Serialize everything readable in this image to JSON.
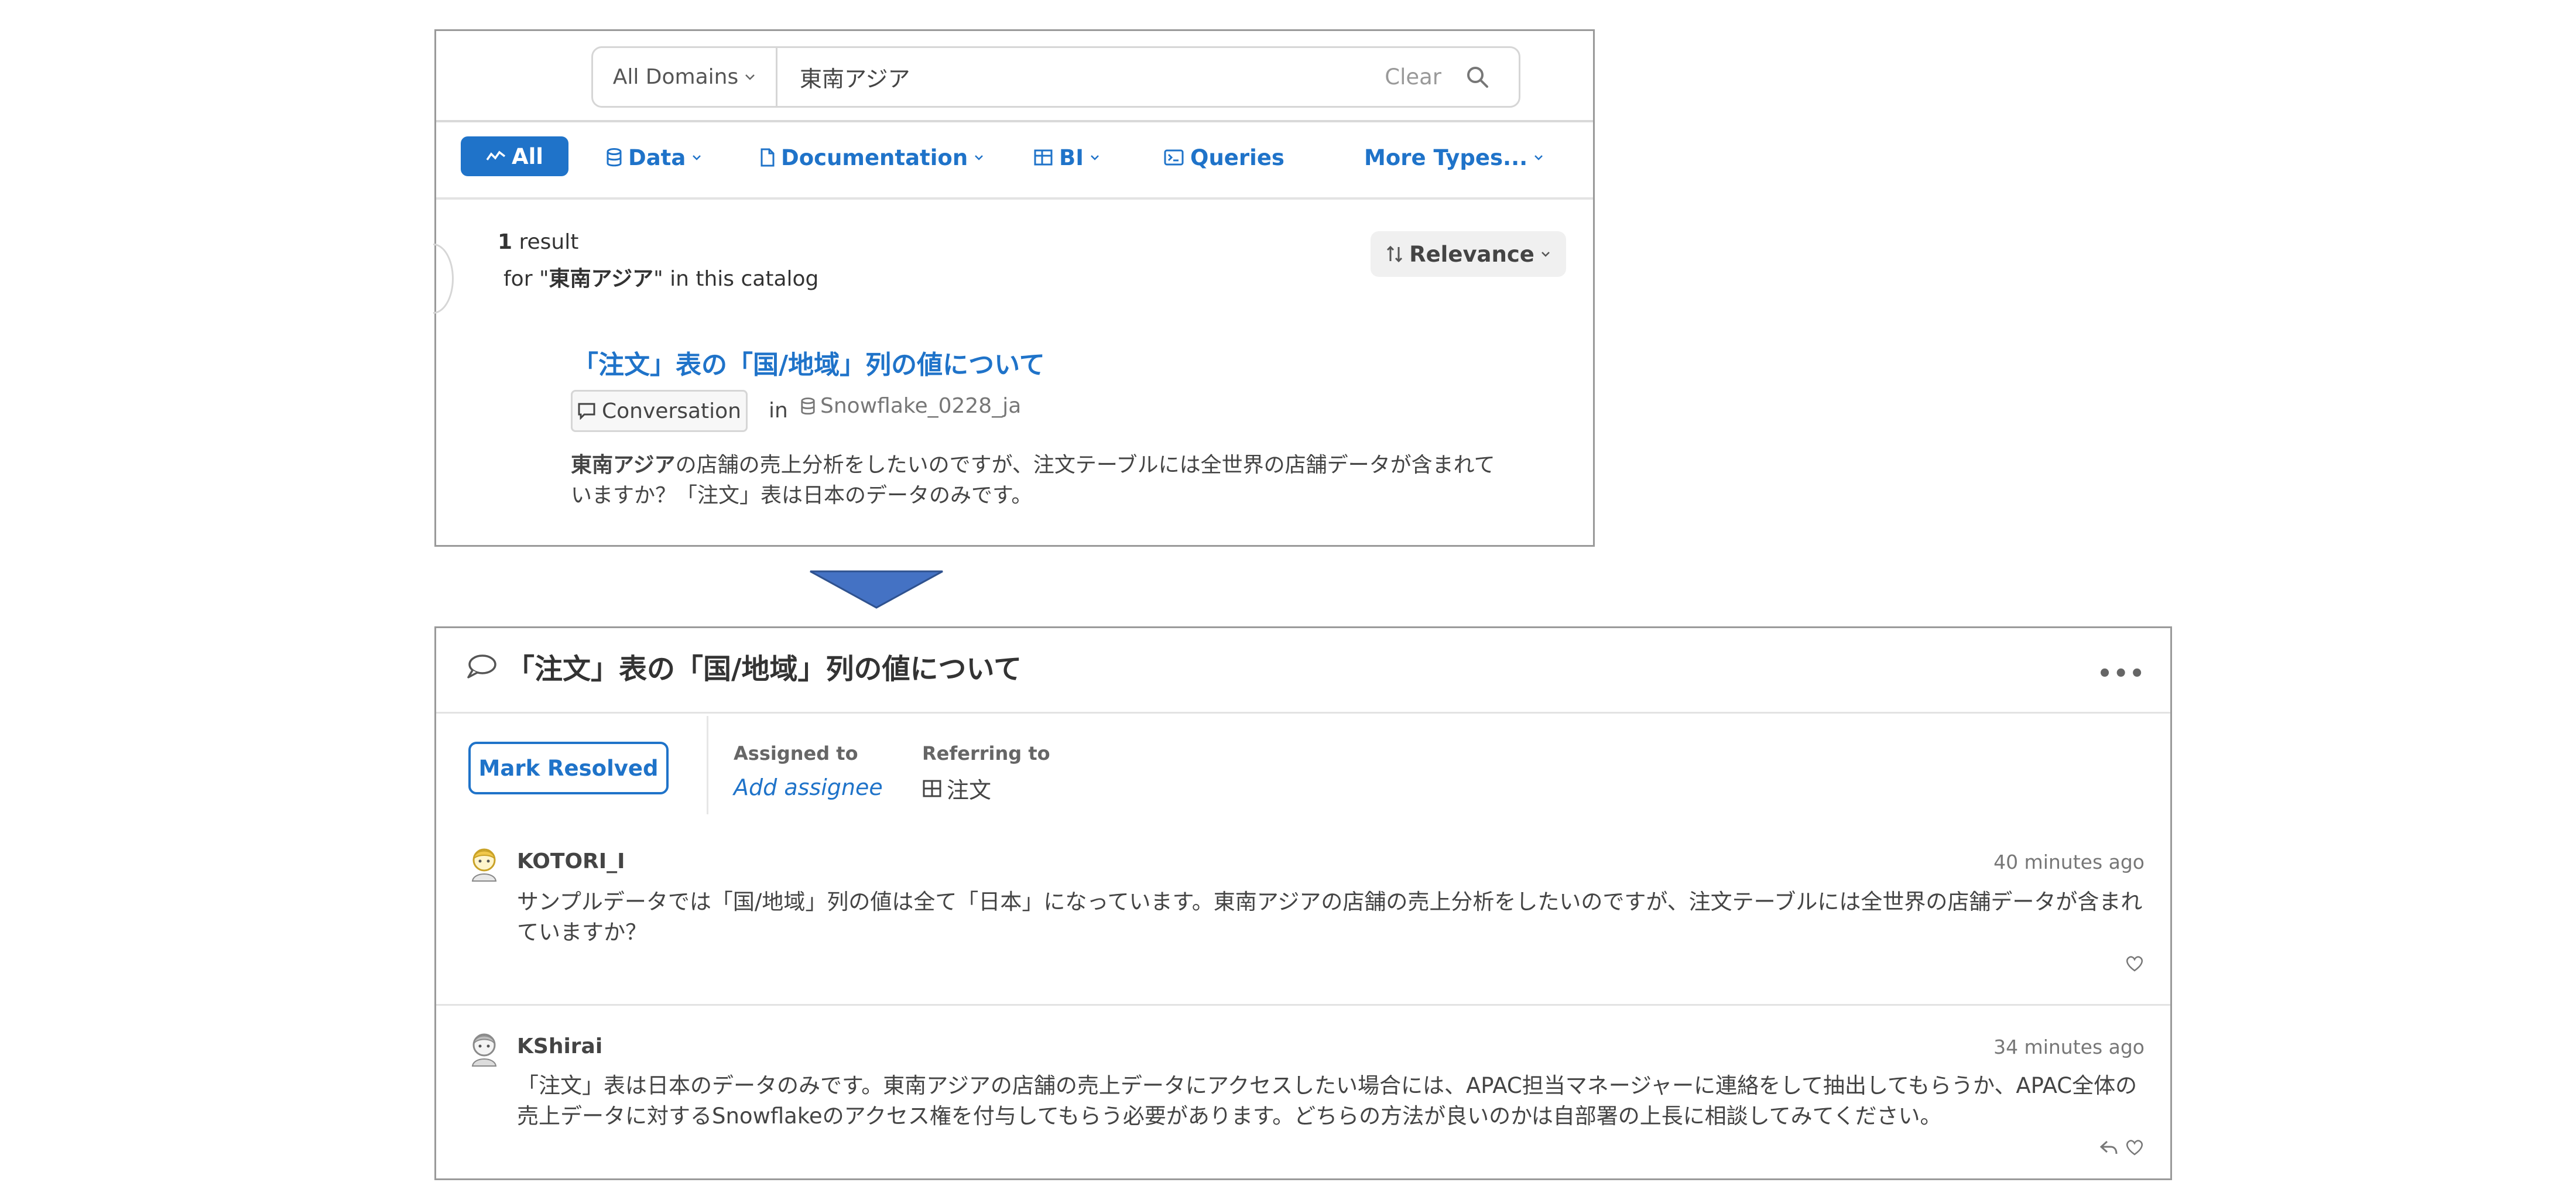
{
  "search": {
    "domain": "All Domains",
    "query": "東南アジア",
    "clear_label": "Clear"
  },
  "types": {
    "all": "All",
    "data": "Data",
    "documentation": "Documentation",
    "bi": "BI",
    "queries": "Queries",
    "more": "More Types..."
  },
  "results": {
    "count": "1",
    "count_suffix": " result",
    "for_prefix": "for \"",
    "for_query": "東南アジア",
    "for_suffix": "\" in this catalog",
    "sort_label": "Relevance",
    "item": {
      "title": "「注文」表の「国/地域」列の値について",
      "type": "Conversation",
      "in_label": "in",
      "source": "Snowflake_0228_ja",
      "snippet_bold": "東南アジア",
      "snippet_rest": "の店舗の売上分析をしたいのですが、注文テーブルには全世界の店舗データが含まれていますか？「注文」表は日本のデータのみです。"
    }
  },
  "conversation": {
    "title": "「注文」表の「国/地域」列の値について",
    "more_label": "•••",
    "mark_resolved": "Mark Resolved",
    "assigned_label": "Assigned to",
    "add_assignee": "Add assignee",
    "referring_label": "Referring to",
    "referring_value": "注文",
    "comments": [
      {
        "author": "KOTORI_I",
        "time": "40 minutes ago",
        "text": "サンプルデータでは「国/地域」列の値は全て「日本」になっています。東南アジアの店舗の売上分析をしたいのですが、注文テーブルには全世界の店舗データが含まれていますか？"
      },
      {
        "author": "KShirai",
        "time": "34 minutes ago",
        "text": "「注文」表は日本のデータのみです。東南アジアの店舗の売上データにアクセスしたい場合には、APAC担当マネージャーに連絡をして抽出してもらうか、APAC全体の売上データに対するSnowflakeのアクセス権を付与してもらう必要があります。どちらの方法が良いのかは自部署の上長に相談してみてください。"
      }
    ]
  },
  "colors": {
    "accent": "#1f73c9",
    "arrow": "#4472c4",
    "border": "#9a9a9a"
  }
}
